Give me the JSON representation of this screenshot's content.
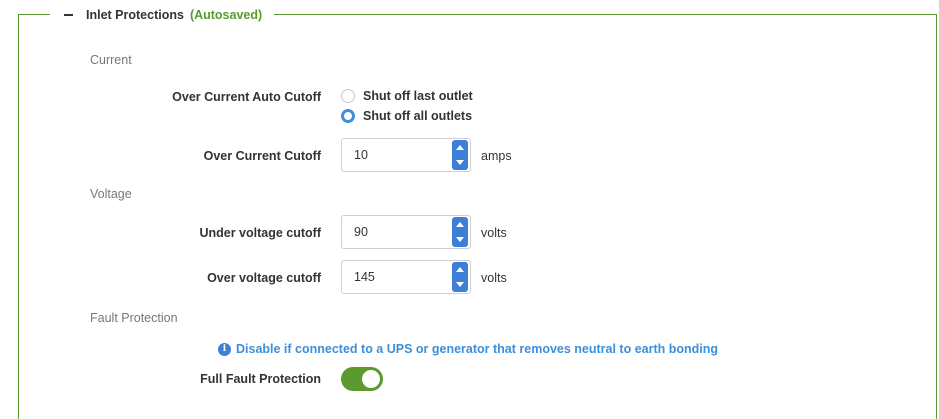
{
  "section": {
    "title": "Inlet Protections",
    "status": "(Autosaved)",
    "accent_color": "#5a9a2e"
  },
  "current": {
    "heading": "Current",
    "auto_cutoff": {
      "label": "Over Current Auto Cutoff",
      "options": [
        {
          "label": "Shut off last outlet",
          "selected": false
        },
        {
          "label": "Shut off all outlets",
          "selected": true
        }
      ]
    },
    "cutoff": {
      "label": "Over Current Cutoff",
      "value": "10",
      "unit": "amps"
    }
  },
  "voltage": {
    "heading": "Voltage",
    "under": {
      "label": "Under voltage cutoff",
      "value": "90",
      "unit": "volts"
    },
    "over": {
      "label": "Over voltage cutoff",
      "value": "145",
      "unit": "volts"
    }
  },
  "fault": {
    "heading": "Fault Protection",
    "note": "Disable if connected to a UPS or generator that removes neutral to earth bonding",
    "info_icon": "info-icon",
    "full": {
      "label": "Full Fault Protection",
      "enabled": true
    }
  }
}
